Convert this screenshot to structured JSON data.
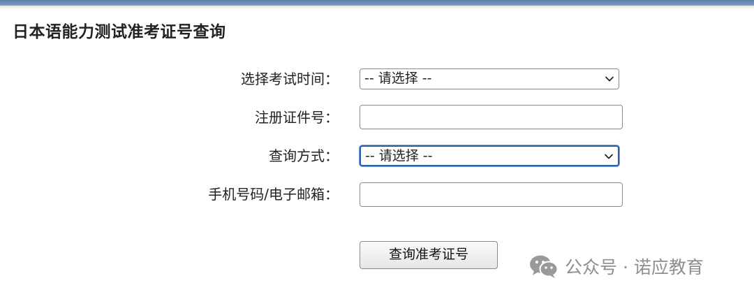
{
  "page": {
    "title": "日本语能力测试准考证号查询"
  },
  "form": {
    "exam_time": {
      "label": "选择考试时间：",
      "selected": "-- 请选择 --"
    },
    "registration_id": {
      "label": "注册证件号：",
      "value": ""
    },
    "query_method": {
      "label": "查询方式：",
      "selected": "-- 请选择 --"
    },
    "contact": {
      "label": "手机号码/电子邮箱：",
      "value": ""
    },
    "submit_label": "查询准考证号"
  },
  "watermark": {
    "text": "公众号 · 诺应教育",
    "icon": "wechat-icon"
  },
  "colors": {
    "top_bar": "#6b8bb4",
    "focus_border": "#2d5ea8",
    "watermark": "#8e8e8e"
  }
}
